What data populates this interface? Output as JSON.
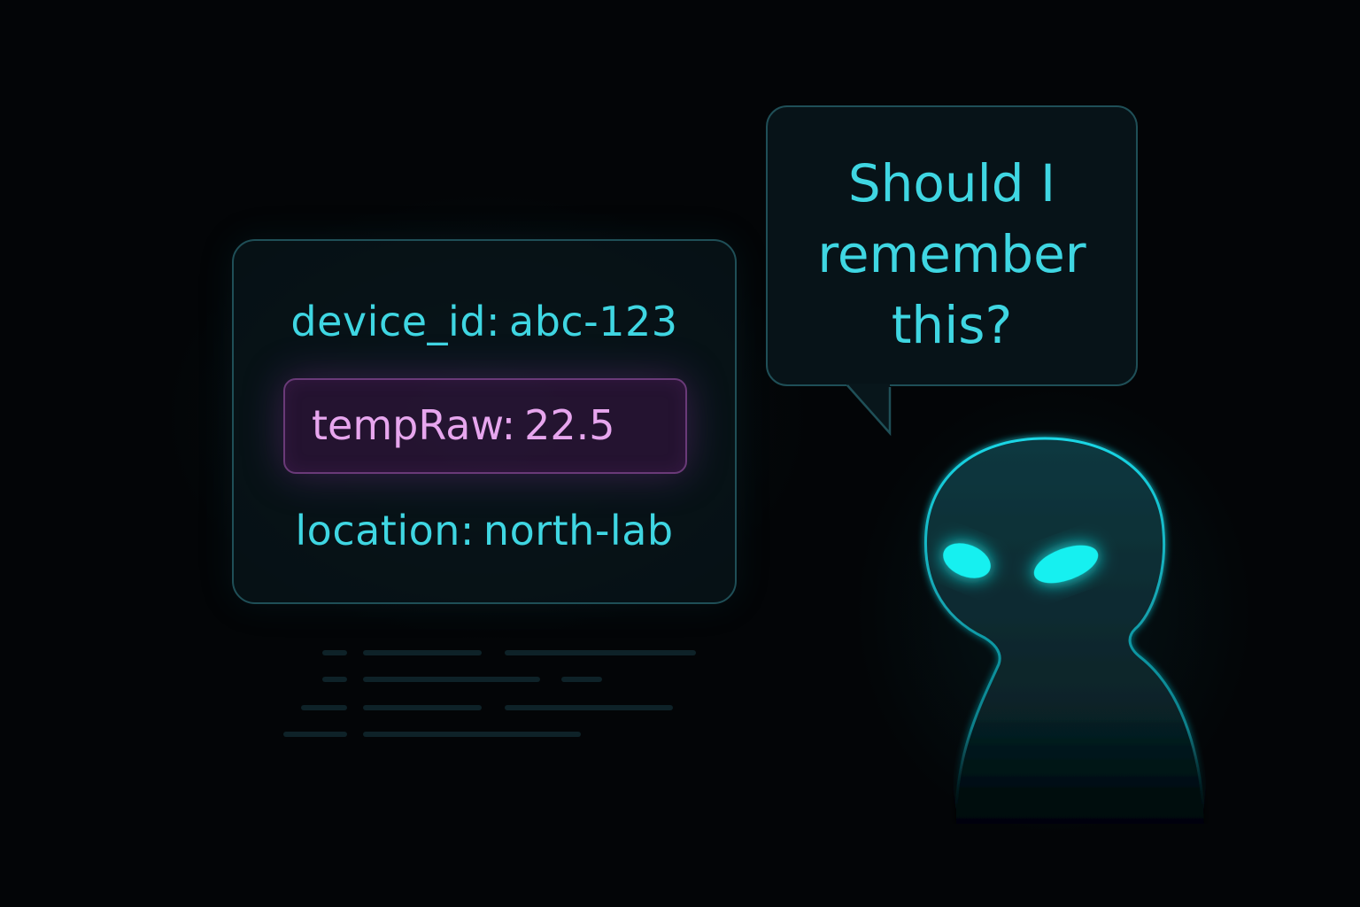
{
  "data_card": {
    "device_label": "device_id:",
    "device_value": "abc-123",
    "temp_label": "tempRaw:",
    "temp_value": "22.5",
    "location_label": "location:",
    "location_value": "north-lab"
  },
  "speech_bubble": {
    "line1": "Should I",
    "line2": "remember",
    "line3": "this?"
  },
  "figure": {
    "icon": "glowing-alien-figure-icon"
  },
  "colors": {
    "background": "#030507",
    "accent_cyan": "#3fd6e2",
    "highlight_pink": "#e7a6ee",
    "highlight_bg": "#3c1446"
  }
}
